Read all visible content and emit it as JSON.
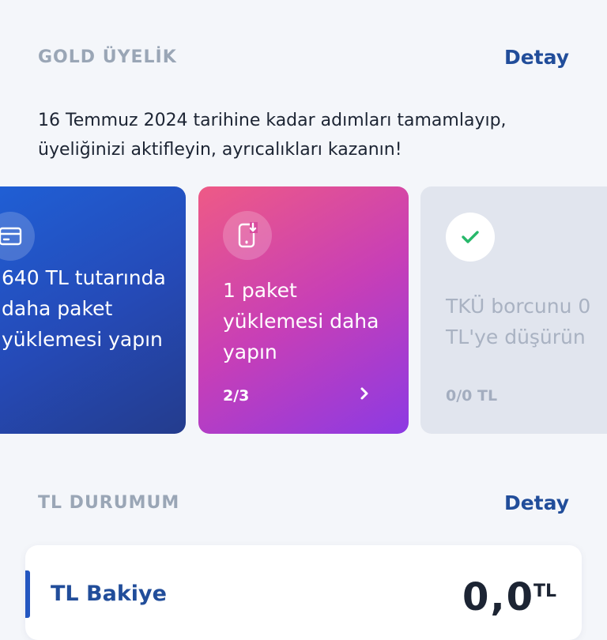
{
  "gold": {
    "title": "GOLD ÜYELİK",
    "detail": "Detay",
    "description": "16 Temmuz 2024 tarihine kadar adımları tamamlayıp, üyeliğinizi aktifleyin, ayrıcalıkları kazanın!"
  },
  "cards": [
    {
      "icon": "credit-card-icon",
      "text": "640 TL tutarında daha paket yüklemesi yapın",
      "color": "#2552c4"
    },
    {
      "icon": "phone-download-icon",
      "text": "1 paket yüklemesi daha yapın",
      "progress": "2/3",
      "color": "#c83fb6"
    },
    {
      "icon": "check-icon",
      "text": "TKÜ borcunu 0 TL'ye düşürün",
      "progress": "0/0 TL",
      "color": "#e1e5ee",
      "check_color": "#27b86a"
    }
  ],
  "tl": {
    "title": "TL DURUMUM",
    "detail": "Detay",
    "balance_label": "TL Bakiye",
    "balance_value": "0,0",
    "balance_unit": "TL"
  }
}
